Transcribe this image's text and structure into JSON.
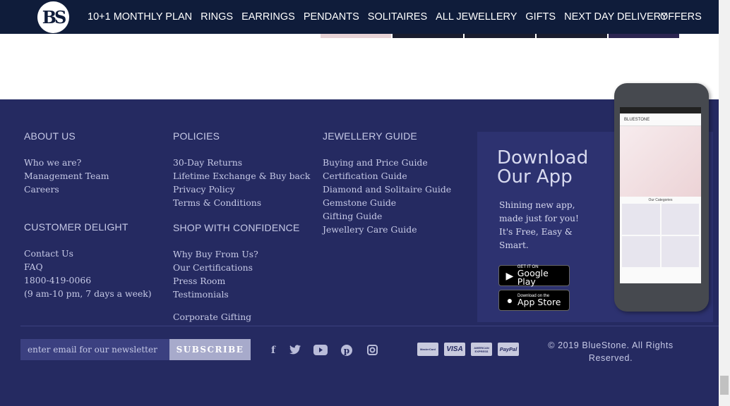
{
  "nav": {
    "logo_text": "BS",
    "items": [
      "10+1 MONTHLY PLAN",
      "RINGS",
      "EARRINGS",
      "PENDANTS",
      "SOLITAIRES",
      "ALL JEWELLERY",
      "GIFTS",
      "NEXT DAY DELIVERY"
    ],
    "offers": "OFFERS"
  },
  "footer": {
    "about": {
      "heading": "ABOUT US",
      "links": [
        "Who we are?",
        "Management Team",
        "Careers"
      ]
    },
    "customer": {
      "heading": "CUSTOMER DELIGHT",
      "links": [
        "Contact Us",
        "FAQ",
        "1800-419-0066",
        "(9 am-10 pm, 7 days a week)"
      ]
    },
    "policies": {
      "heading": "POLICIES",
      "links": [
        "30-Day Returns",
        "Lifetime Exchange & Buy back",
        "Privacy Policy",
        "Terms & Conditions"
      ]
    },
    "shop": {
      "heading": "SHOP WITH CONFIDENCE",
      "links": [
        "Why Buy From Us?",
        "Our Certifications",
        "Press Room",
        "Testimonials"
      ],
      "corporate": "Corporate Gifting"
    },
    "guide": {
      "heading": "JEWELLERY GUIDE",
      "links": [
        "Buying and Price Guide",
        "Certification Guide",
        "Diamond and Solitaire Guide",
        "Gemstone Guide",
        "Gifting Guide",
        "Jewellery Care Guide"
      ]
    },
    "app": {
      "title": "Download Our App",
      "text": "Shining new app, made just for you! It's Free, Easy & Smart.",
      "google_small": "GET IT ON",
      "google_big": "Google Play",
      "apple_small": "Download on the",
      "apple_big": "App Store",
      "phone_brand": "BLUESTONE",
      "phone_categories": "Our Categories"
    },
    "newsletter": {
      "placeholder": "enter email for our newsletter",
      "button": "SUBSCRIBE"
    },
    "payments": [
      "MasterCard",
      "VISA",
      "AMERICAN EXPRESS",
      "PayPal"
    ],
    "copyright": "© 2019 BlueStone. All Rights Reserved."
  }
}
